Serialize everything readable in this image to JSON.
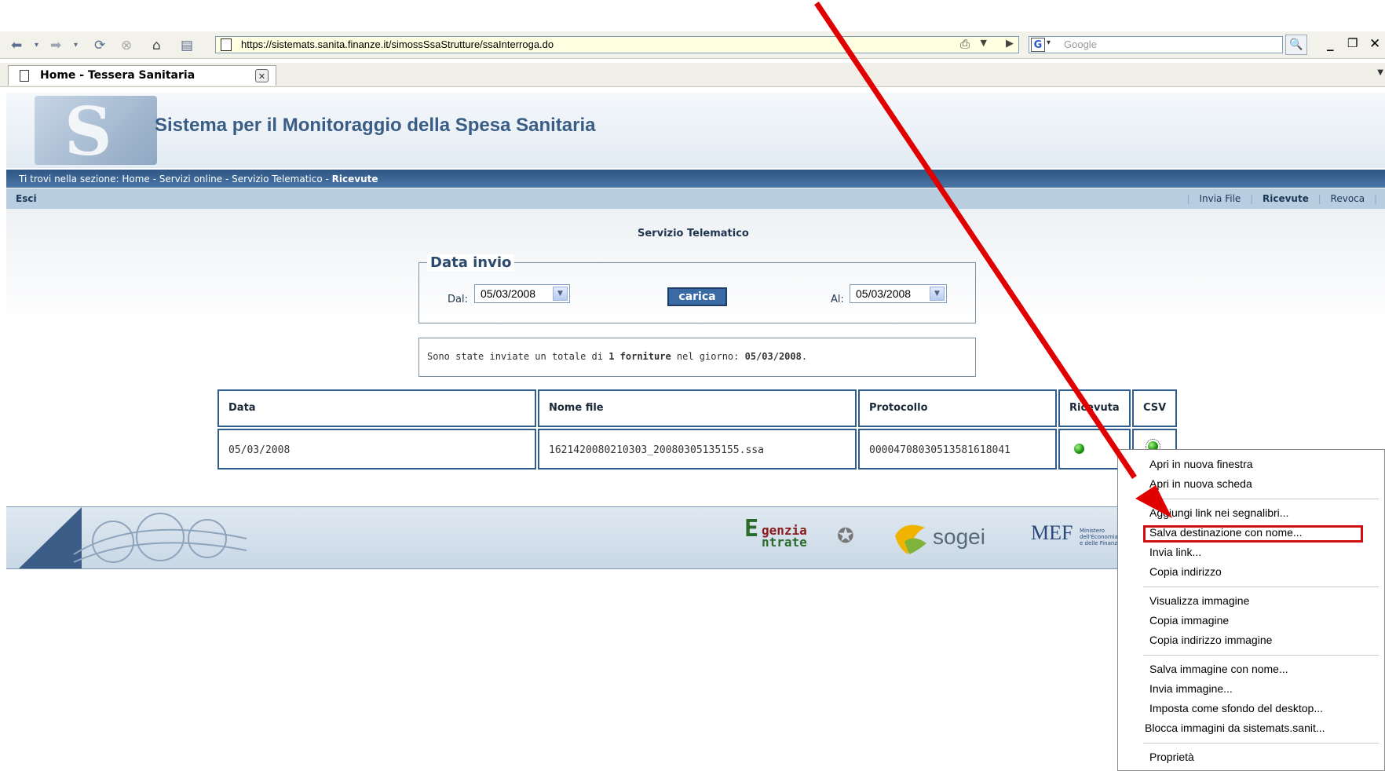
{
  "browser": {
    "url": "https://sistemats.sanita.finanze.it/simossSsaStrutture/ssaInterroga.do",
    "search_placeholder": "Google",
    "search_engine_letter": "G",
    "tab_title": "Home - Tessera Sanitaria"
  },
  "site": {
    "title": "Sistema per il Monitoraggio della Spesa Sanitaria",
    "logo_text": "S",
    "breadcrumb_prefix": "Ti trovi nella sezione: Home - Servizi online - Servizio Telematico - ",
    "breadcrumb_current": "Ricevute",
    "menu_left": "Esci",
    "menu_right": [
      "Invia File",
      "Ricevute",
      "Revoca"
    ]
  },
  "content": {
    "section_title": "Servizio Telematico",
    "fieldset_legend": "Data invio",
    "dal_label": "Dal:",
    "dal_value": "05/03/2008",
    "al_label": "Al:",
    "al_value": "05/03/2008",
    "carica_label": "carica",
    "summary_pre": "Sono state inviate un totale di ",
    "summary_count": "1",
    "summary_mid1": " ",
    "summary_word": "forniture",
    "summary_mid2": " nel giorno: ",
    "summary_date": "05/03/2008",
    "summary_end": ".",
    "table": {
      "headers": [
        "Data",
        "Nome file",
        "Protocollo",
        "Ricevuta",
        "CSV"
      ],
      "rows": [
        {
          "data": "05/03/2008",
          "nome_file": "1621420080210303_20080305135155.ssa",
          "protocollo": "00004708030513581618041"
        }
      ]
    }
  },
  "footer": {
    "agenzia_line1": "genzia",
    "agenzia_line2": "ntrate",
    "agenzia_initial": "E",
    "sogei": "sogei",
    "mef": "MEF",
    "mef_sub": [
      "Ministero",
      "dell'Economia",
      "e delle Finanze"
    ]
  },
  "context_menu": {
    "items": [
      "Apri in nuova finestra",
      "Apri in nuova scheda",
      "Aggiungi link nei segnalibri...",
      "Salva destinazione con nome...",
      "Invia link...",
      "Copia indirizzo",
      "Visualizza immagine",
      "Copia immagine",
      "Copia indirizzo immagine",
      "Salva immagine con nome...",
      "Invia immagine...",
      "Imposta come sfondo del desktop...",
      "Blocca immagini da sistemats.sanit...",
      "Proprietà"
    ],
    "highlighted": "Salva destinazione con nome..."
  },
  "colors": {
    "annotation_red": "#e00000",
    "header_blue": "#2f5684",
    "title_blue": "#3a5d86"
  }
}
